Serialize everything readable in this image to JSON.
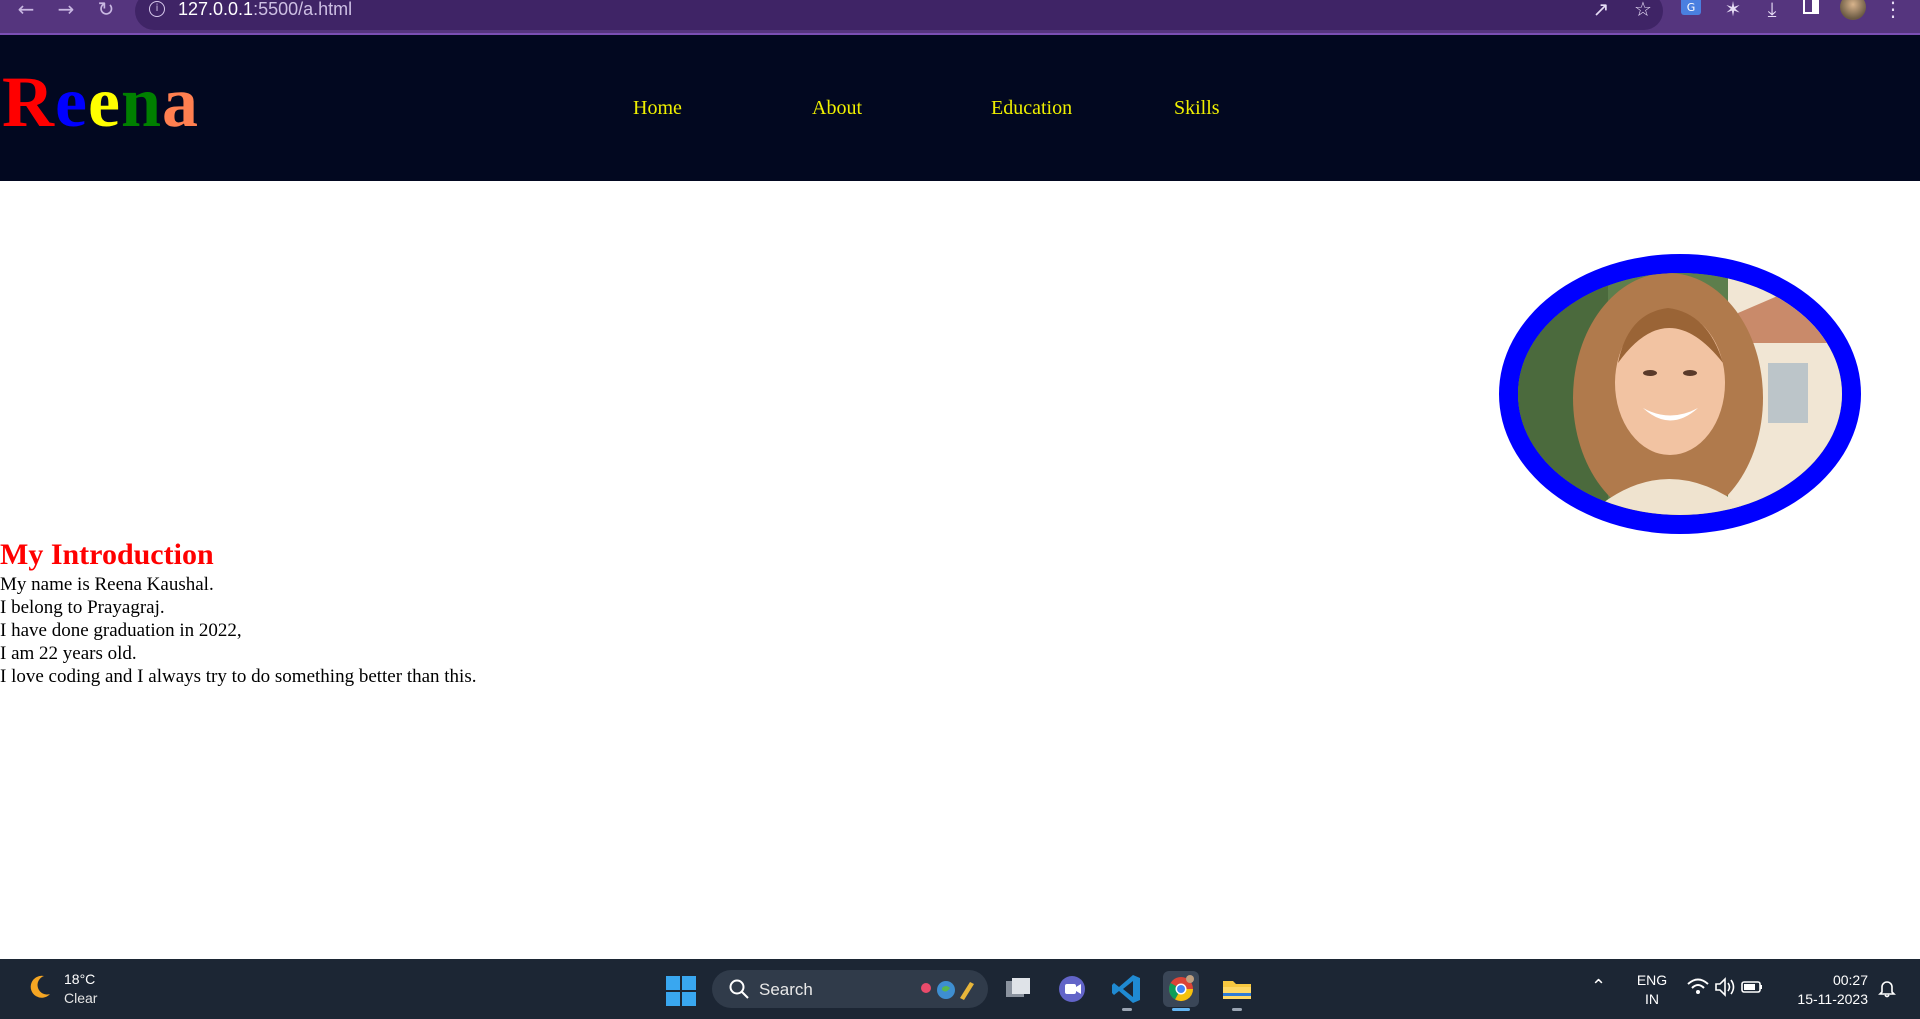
{
  "browser": {
    "url_host": "127.0.0.1",
    "url_rest": ":5500/a.html"
  },
  "site": {
    "logo": {
      "letters": [
        {
          "char": "R",
          "color": "#ff0000"
        },
        {
          "char": "e",
          "color": "#0000ff"
        },
        {
          "char": "e",
          "color": "#ffff00"
        },
        {
          "char": "n",
          "color": "#008000"
        },
        {
          "char": "a",
          "color": "#ff7f50"
        }
      ]
    },
    "nav": {
      "home": "Home",
      "about": "About",
      "education": "Education",
      "skills": "Skills"
    },
    "nav_color": "#f0f000",
    "header_bg": "#020820",
    "photo_border_color": "#0000ff"
  },
  "intro": {
    "title": "My Introduction",
    "title_color": "#ff0000",
    "lines": [
      "My name is Reena Kaushal.",
      "I belong to Prayagraj.",
      "I have done graduation in 2022,",
      "I am 22 years old.",
      "I love coding and I always try to do something better than this."
    ]
  },
  "taskbar": {
    "weather_temp": "18°C",
    "weather_desc": "Clear",
    "search_label": "Search",
    "lang_line1": "ENG",
    "lang_line2": "IN",
    "time": "00:27",
    "date": "15-11-2023",
    "apps": [
      "file-explorer-widget",
      "teams-chat",
      "vs-code",
      "chrome",
      "file-explorer"
    ]
  }
}
